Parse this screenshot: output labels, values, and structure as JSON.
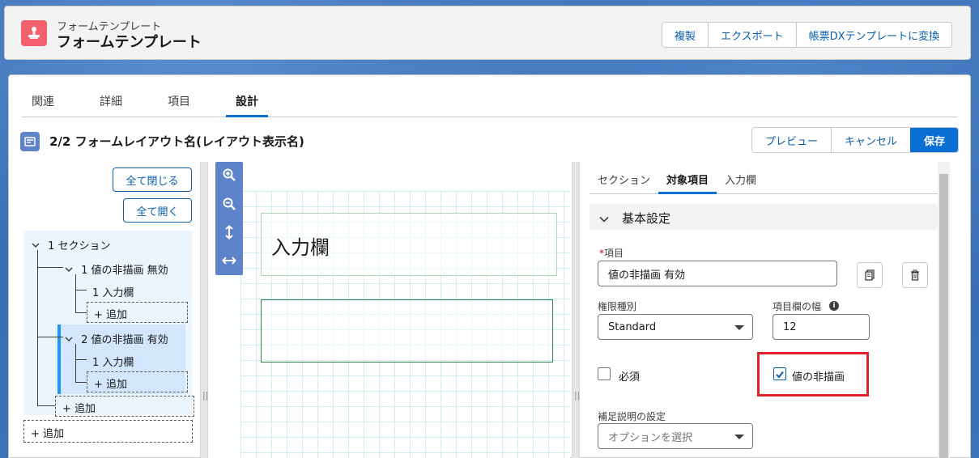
{
  "header": {
    "subtitle": "フォームテンプレート",
    "title": "フォームテンプレート",
    "actions": [
      "複製",
      "エクスポート",
      "帳票DXテンプレートに変換"
    ]
  },
  "tabs": [
    {
      "label": "関連",
      "active": false
    },
    {
      "label": "詳細",
      "active": false
    },
    {
      "label": "項目",
      "active": false
    },
    {
      "label": "設計",
      "active": true
    }
  ],
  "section": {
    "title": "2/2 フォームレイアウト名(レイアウト表示名)",
    "actions": [
      "プレビュー",
      "キャンセル",
      "保存"
    ]
  },
  "tree": {
    "collapse_all": "全て閉じる",
    "expand_all": "全て開く",
    "nodes": {
      "section1": "1 セクション",
      "item1": "1 値の非描画 無効",
      "item1_field": "1 入力欄",
      "item1_add": "+ 追加",
      "item2": "2 値の非描画 有効",
      "item2_field": "1 入力欄",
      "item2_add": "+ 追加",
      "section_add": "+ 追加",
      "root_add": "+ 追加"
    }
  },
  "canvas": {
    "field_label": "入力欄"
  },
  "props": {
    "tabs": [
      {
        "label": "セクション",
        "active": false
      },
      {
        "label": "対象項目",
        "active": true
      },
      {
        "label": "入力欄",
        "active": false
      }
    ],
    "accordion_label": "基本設定",
    "item_label": "項目",
    "item_value": "値の非描画 有効",
    "permission_label": "権限種別",
    "permission_value": "Standard",
    "width_label": "項目欄の幅",
    "width_value": "12",
    "required_label": "必須",
    "required_checked": false,
    "hide_value_label": "値の非描画",
    "hide_value_checked": true,
    "help_label": "補足説明の設定",
    "help_placeholder": "オプションを選択"
  },
  "colors": {
    "brand": "#0b6ed5",
    "highlight": "#e3202b",
    "app_icon": "#f4606b"
  }
}
